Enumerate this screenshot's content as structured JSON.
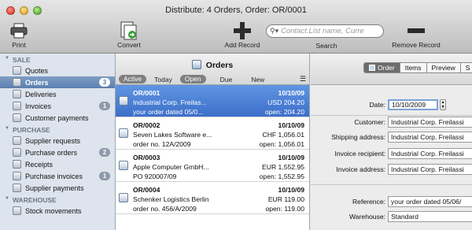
{
  "window": {
    "title": "Distribute: 4 Orders, Order: OR/0001"
  },
  "toolbar": {
    "print": "Print",
    "convert": "Convert",
    "add_record": "Add Record",
    "search_placeholder": "Contact.List name, Curre",
    "search_label": "Search",
    "remove_record": "Remove Record"
  },
  "sidebar": {
    "sections": [
      {
        "title": "SALE",
        "items": [
          {
            "label": "Quotes",
            "badge": ""
          },
          {
            "label": "Orders",
            "badge": "3",
            "selected": true
          },
          {
            "label": "Deliveries",
            "badge": ""
          },
          {
            "label": "Invoices",
            "badge": "1"
          },
          {
            "label": "Customer payments",
            "badge": ""
          }
        ]
      },
      {
        "title": "PURCHASE",
        "items": [
          {
            "label": "Supplier requests",
            "badge": ""
          },
          {
            "label": "Purchase orders",
            "badge": "2"
          },
          {
            "label": "Receipts",
            "badge": ""
          },
          {
            "label": "Purchase invoices",
            "badge": "1"
          },
          {
            "label": "Supplier payments",
            "badge": ""
          }
        ]
      },
      {
        "title": "WAREHOUSE",
        "items": [
          {
            "label": "Stock movements",
            "badge": ""
          }
        ]
      }
    ]
  },
  "list": {
    "title": "Orders",
    "filters": [
      "Active",
      "Today",
      "Open",
      "Due",
      "New"
    ],
    "rows": [
      {
        "id": "OR/0001",
        "date": "10/10/09",
        "name": "Industrial Corp. Freilas...",
        "amount": "USD 204.20",
        "ref": "your order dated 05/0...",
        "open": "open: 204.20",
        "selected": true
      },
      {
        "id": "OR/0002",
        "date": "10/10/09",
        "name": "Seven Lakes Software e...",
        "amount": "CHF 1,056.01",
        "ref": "order no. 12A/2009",
        "open": "open: 1,056.01"
      },
      {
        "id": "OR/0003",
        "date": "10/10/09",
        "name": "Apple Computer GmbH...",
        "amount": "EUR 1,552.95",
        "ref": "PO 920007/09",
        "open": "open: 1,552.95"
      },
      {
        "id": "OR/0004",
        "date": "10/10/09",
        "name": "Schenker Logistics Berlin",
        "amount": "EUR 119.00",
        "ref": "order no. 456/A/2009",
        "open": "open: 119.00"
      }
    ]
  },
  "detail": {
    "tabs": [
      "Order",
      "Items",
      "Preview",
      "S"
    ],
    "date_label": "Date:",
    "date_value": "10/10/2009",
    "customer_label": "Customer:",
    "customer_value": "Industrial Corp. Freilassi",
    "shipping_label": "Shipping address:",
    "shipping_value": "Industrial Corp. Freilassi",
    "invoice_recipient_label": "Invoice recipient:",
    "invoice_recipient_value": "Industrial Corp. Freilassi",
    "invoice_address_label": "Invoice address:",
    "invoice_address_value": "Industrial Corp. Freilassi",
    "reference_label": "Reference:",
    "reference_value": "your order dated 05/06/",
    "warehouse_label": "Warehouse:",
    "warehouse_value": "Standard"
  }
}
